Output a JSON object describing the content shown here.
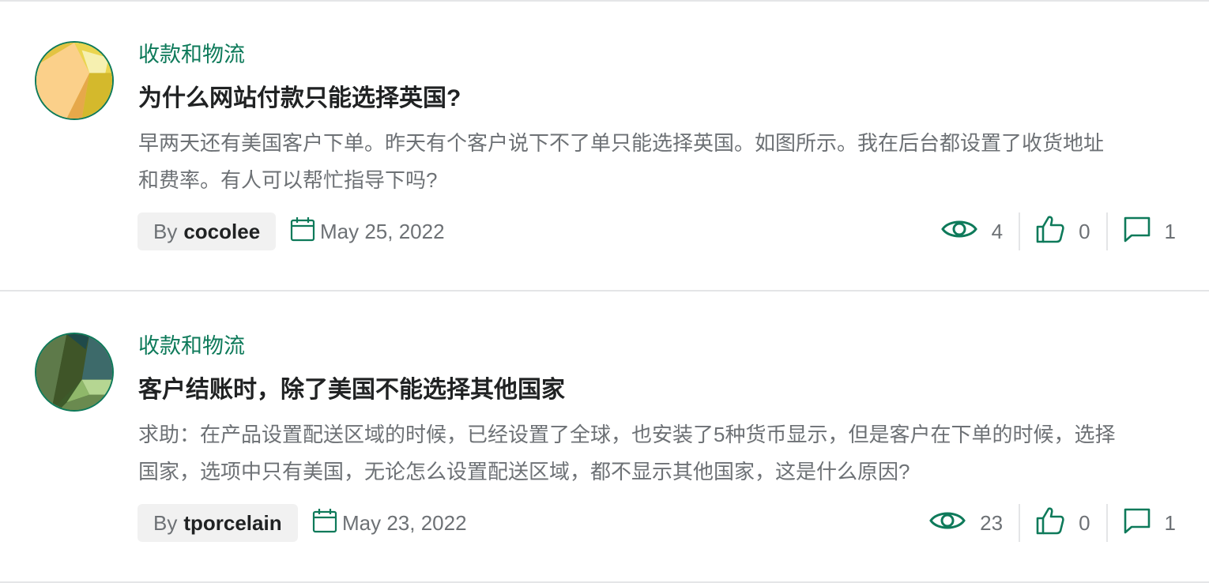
{
  "posts": [
    {
      "category": "收款和物流",
      "title": "为什么网站付款只能选择英国?",
      "excerpt": "早两天还有美国客户下单。昨天有个客户说下不了单只能选择英国。如图所示。我在后台都设置了收货地址和费率。有人可以帮忙指导下吗?",
      "by_label": "By",
      "author": "cocolee",
      "date": "May 25, 2022",
      "views": "4",
      "likes": "0",
      "replies": "1"
    },
    {
      "category": "收款和物流",
      "title": "客户结账时，除了美国不能选择其他国家",
      "excerpt": "求助：在产品设置配送区域的时候，已经设置了全球，也安装了5种货币显示，但是客户在下单的时候，选择国家，选项中只有美国，无论怎么设置配送区域，都不显示其他国家，这是什么原因?",
      "by_label": "By",
      "author": "tporcelain",
      "date": "May 23, 2022",
      "views": "23",
      "likes": "0",
      "replies": "1"
    }
  ],
  "colors": {
    "accent": "#0e7a5a",
    "text": "#202223",
    "muted": "#6d7175",
    "pill_bg": "#f1f1f1",
    "divider": "#e4e5e7"
  },
  "icons": {
    "date": "calendar-icon",
    "views": "eye-icon",
    "likes": "thumbs-up-icon",
    "replies": "comment-icon"
  }
}
